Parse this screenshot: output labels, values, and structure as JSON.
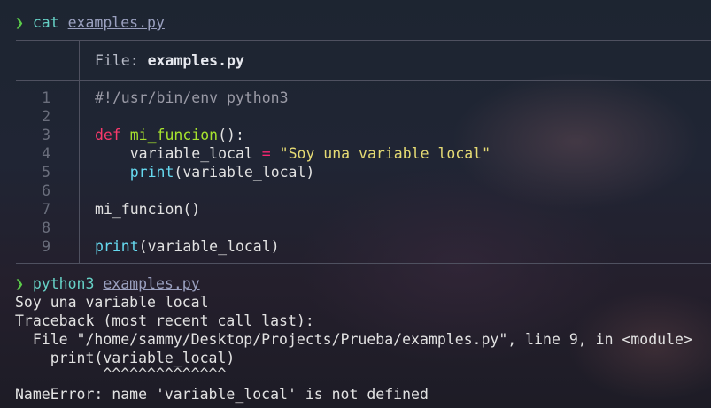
{
  "prompt1": {
    "symbol": "❯",
    "command": "cat",
    "argument": "examples.py"
  },
  "header": {
    "label": "File: ",
    "filename": "examples.py"
  },
  "code": {
    "line_numbers": [
      "1",
      "2",
      "3",
      "4",
      "5",
      "6",
      "7",
      "8",
      "9"
    ],
    "shebang": "#!/usr/bin/env python3",
    "def_kw": "def",
    "def_name": "mi_funcion",
    "def_tail": "():",
    "assign_var": "variable_local",
    "assign_op": "=",
    "assign_str": "\"Soy una variable local\"",
    "print_fn": "print",
    "print_args": "(variable_local)",
    "call_line": "mi_funcion()",
    "print2_fn": "print",
    "print2_args": "(variable_local)"
  },
  "prompt2": {
    "symbol": "❯",
    "command": "python3",
    "argument": "examples.py"
  },
  "output": {
    "line1": "Soy una variable local",
    "line2": "Traceback (most recent call last):",
    "line3": "  File \"/home/sammy/Desktop/Projects/Prueba/examples.py\", line 9, in <module>",
    "line4": "    print(variable_local)",
    "line5": "          ^^^^^^^^^^^^^^",
    "line6": "NameError: name 'variable_local' is not defined"
  },
  "colors": {
    "prompt_arrow": "#5ccd4a",
    "command": "#66d1c6",
    "keyword": "#f8396b",
    "function": "#a6e22e",
    "builtin": "#66d9ef",
    "string": "#e6db74"
  }
}
